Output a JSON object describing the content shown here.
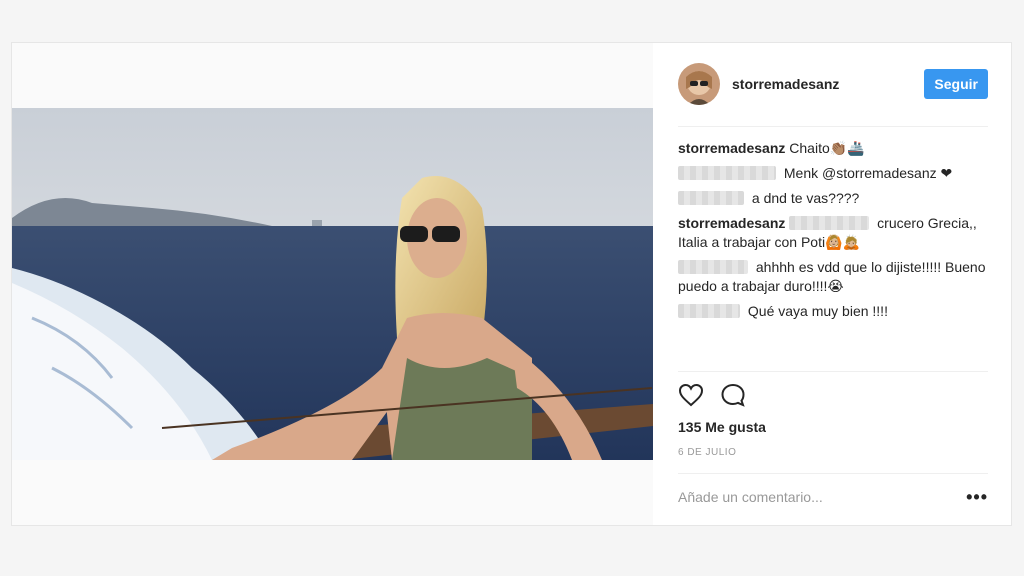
{
  "post": {
    "username": "storremadesanz",
    "follow_label": "Seguir",
    "likes": "135 Me gusta",
    "date": "6 DE JULIO",
    "add_comment_placeholder": "Añade un comentario...",
    "more_options": "•••"
  },
  "comments": [
    {
      "user": "storremadesanz",
      "user_blurred": false,
      "text": "Chaito👏🏽🚢"
    },
    {
      "user": "",
      "user_blurred": true,
      "text": "Menk @storremadesanz ❤"
    },
    {
      "user": "",
      "user_blurred": true,
      "text": "a dnd te vas????"
    },
    {
      "user": "storremadesanz",
      "user_blurred": false,
      "text_blurred_prefix": true,
      "text": "crucero Grecia,, Italia a trabajar con Poti🙆🏼🙇🏼"
    },
    {
      "user": "",
      "user_blurred": true,
      "text": "ahhhh es vdd que lo dijiste!!!!! Bueno puedo a trabajar duro!!!!😭"
    },
    {
      "user": "",
      "user_blurred": true,
      "text": "Qué vaya muy bien !!!!"
    }
  ],
  "icons": {
    "like": "heart-icon",
    "comment": "comment-icon",
    "more": "more-options-icon"
  },
  "colors": {
    "follow_button": "#3897f0",
    "page_background": "#f5f5f5",
    "muted_text": "#999999"
  }
}
